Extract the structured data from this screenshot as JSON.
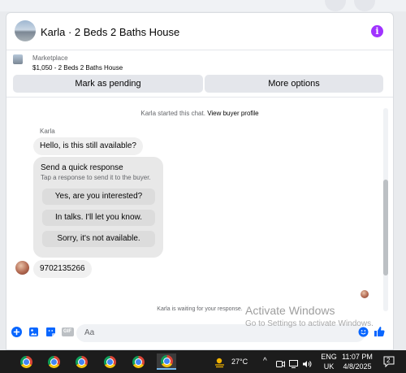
{
  "header": {
    "title": "Karla · 2 Beds 2 Baths House",
    "info_icon_glyph": "i"
  },
  "listing": {
    "category": "Marketplace",
    "price_line": "$1,050 - 2 Beds 2 Baths House",
    "mark_pending_label": "Mark as pending",
    "more_options_label": "More options"
  },
  "chat": {
    "started_text": "Karla started this chat.",
    "view_profile_link": "View buyer profile",
    "sender_name": "Karla",
    "first_message": "Hello, is this still available?",
    "quick_response": {
      "title": "Send a quick response",
      "subtitle": "Tap a response to send it to the buyer.",
      "options": [
        "Yes, are you interested?",
        "In talks. I'll let you know.",
        "Sorry, it's not available."
      ]
    },
    "phone_message": "9702135266",
    "waiting_text": "Karla is waiting for your response."
  },
  "composer": {
    "placeholder": "Aa",
    "gif_label": "GIF"
  },
  "watermark": {
    "line1": "Activate Windows",
    "line2": "Go to Settings to activate Windows."
  },
  "taskbar": {
    "temperature": "27°C",
    "language_line1": "ENG",
    "language_line2": "UK",
    "time": "11:07 PM",
    "date": "4/8/2025",
    "notification_count": "2"
  },
  "colors": {
    "accent": "#0866ff",
    "info_icon": "#a033ff",
    "taskbar": "#1c1c1c"
  }
}
